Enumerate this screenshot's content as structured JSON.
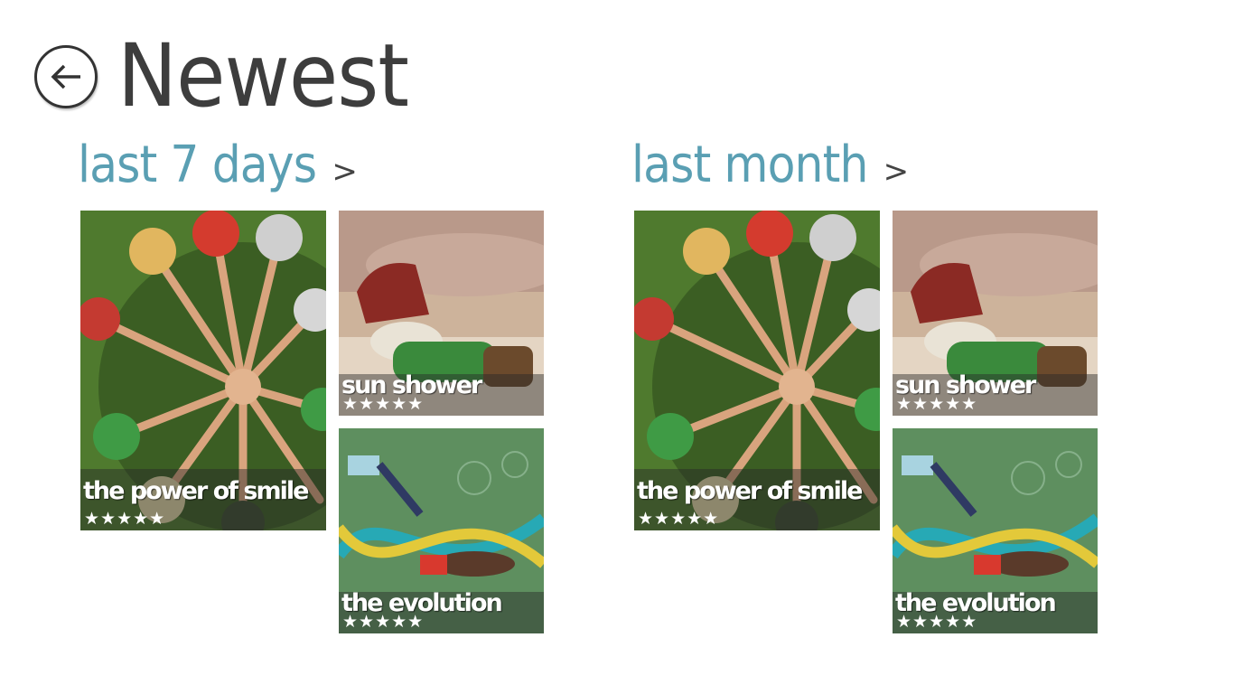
{
  "header": {
    "title": "Newest"
  },
  "groups": [
    {
      "title": "last 7 days",
      "chevron": ">",
      "tiles": [
        {
          "title": "the power of smile",
          "rating": "★★★★★"
        },
        {
          "title": "sun shower",
          "rating": "★★★★★"
        },
        {
          "title": "the evolution",
          "rating": "★★★★★"
        }
      ]
    },
    {
      "title": "last month",
      "chevron": ">",
      "tiles": [
        {
          "title": "the power of smile",
          "rating": "★★★★★"
        },
        {
          "title": "sun shower",
          "rating": "★★★★★"
        },
        {
          "title": "the evolution",
          "rating": "★★★★★"
        }
      ]
    }
  ],
  "colors": {
    "accent": "#5a9fb3",
    "title": "#3d3d3d",
    "background": "#ffffff"
  },
  "icons": {
    "back": "back-arrow-icon"
  }
}
